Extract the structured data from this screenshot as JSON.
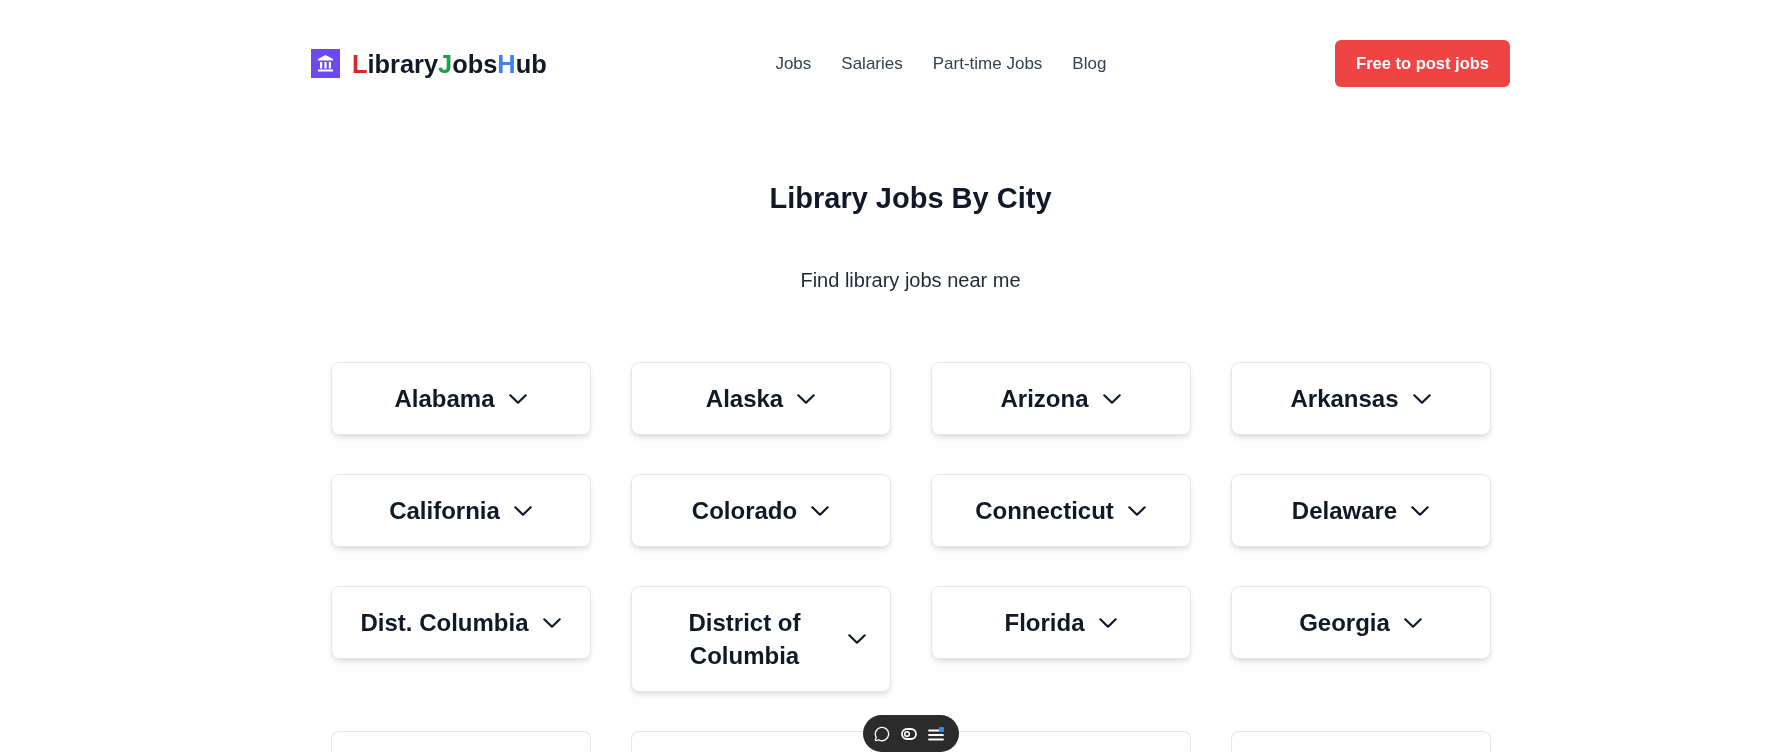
{
  "header": {
    "logo": {
      "parts": [
        {
          "text": "L",
          "color": "#dc2626"
        },
        {
          "text": "ibrary",
          "color": "#111827"
        },
        {
          "text": "J",
          "color": "#16a34a"
        },
        {
          "text": "obs",
          "color": "#111827"
        },
        {
          "text": "H",
          "color": "#3b82f6"
        },
        {
          "text": "ub",
          "color": "#111827"
        }
      ]
    },
    "nav": [
      "Jobs",
      "Salaries",
      "Part-time Jobs",
      "Blog"
    ],
    "cta_button": "Free to post jobs"
  },
  "heading": {
    "title": "Library Jobs By City",
    "subtitle": "Find library jobs near me"
  },
  "states": [
    {
      "label": "Alabama",
      "expanded": false
    },
    {
      "label": "Alaska",
      "expanded": false
    },
    {
      "label": "Arizona",
      "expanded": false
    },
    {
      "label": "Arkansas",
      "expanded": false
    },
    {
      "label": "California",
      "expanded": false
    },
    {
      "label": "Colorado",
      "expanded": false
    },
    {
      "label": "Connecticut",
      "expanded": false
    },
    {
      "label": "Delaware",
      "expanded": false
    },
    {
      "label": "Dist. Columbia",
      "expanded": false
    },
    {
      "label": "District of Columbia",
      "expanded": false
    },
    {
      "label": "Florida",
      "expanded": false
    },
    {
      "label": "Georgia",
      "expanded": false
    }
  ],
  "partial_cards": [
    {
      "kind": "dropdown"
    },
    {
      "kind": "dropdown"
    },
    {
      "kind": "dropdown"
    },
    {
      "kind": "dropdown"
    }
  ]
}
